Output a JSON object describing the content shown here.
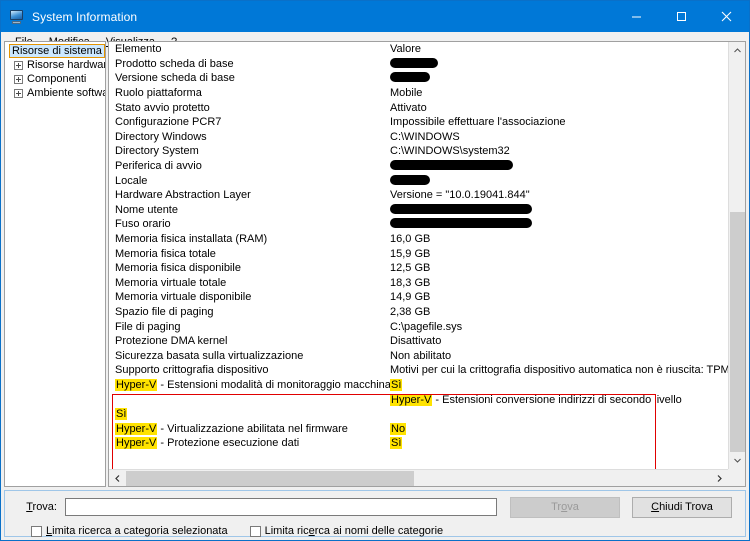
{
  "window": {
    "title": "System Information",
    "icon": "system-information-icon",
    "minimize": "–",
    "maximize": "□",
    "close": "✕"
  },
  "menu": [
    {
      "label": "File",
      "accel": "F"
    },
    {
      "label": "Modifica",
      "accel": "M"
    },
    {
      "label": "Visualizza",
      "accel": "V"
    },
    {
      "label": "?",
      "accel": ""
    }
  ],
  "tree": {
    "root": "Risorse di sistema",
    "children": [
      "Risorse hardware",
      "Componenti",
      "Ambiente software"
    ]
  },
  "list": {
    "columns": [
      "Elemento",
      "Valore"
    ],
    "rows": [
      {
        "item": "Prodotto scheda di base",
        "value": "",
        "redact": 48
      },
      {
        "item": "Versione scheda di base",
        "value": "",
        "redact": 40
      },
      {
        "item": "Ruolo piattaforma",
        "value": "Mobile"
      },
      {
        "item": "Stato avvio protetto",
        "value": "Attivato"
      },
      {
        "item": "Configurazione PCR7",
        "value": "Impossibile effettuare l'associazione"
      },
      {
        "item": "Directory Windows",
        "value": "C:\\WINDOWS"
      },
      {
        "item": "Directory System",
        "value": "C:\\WINDOWS\\system32"
      },
      {
        "item": "Periferica di avvio",
        "value": "",
        "redact": 123
      },
      {
        "item": "Locale",
        "value": "",
        "redact": 40
      },
      {
        "item": "Hardware Abstraction Layer",
        "value": "Versione = \"10.0.19041.844\""
      },
      {
        "item": "Nome utente",
        "value": "",
        "redact": 142
      },
      {
        "item": "Fuso orario",
        "value": "",
        "redact": 142
      },
      {
        "item": "Memoria fisica installata (RAM)",
        "value": "16,0 GB"
      },
      {
        "item": "Memoria fisica totale",
        "value": "15,9 GB"
      },
      {
        "item": "Memoria fisica disponibile",
        "value": "12,5 GB"
      },
      {
        "item": "Memoria virtuale totale",
        "value": "18,3 GB"
      },
      {
        "item": "Memoria virtuale disponibile",
        "value": "14,9 GB"
      },
      {
        "item": "Spazio file di paging",
        "value": "2,38 GB"
      },
      {
        "item": "File di paging",
        "value": "C:\\pagefile.sys"
      },
      {
        "item": "Protezione DMA kernel",
        "value": "Disattivato"
      },
      {
        "item": "Sicurezza basata sulla virtualizzazione",
        "value": "Non abilitato"
      },
      {
        "item": "Supporto crittografia dispositivo",
        "value": "Motivi per cui la crittografia dispositivo automatica non è riuscita: TPM non util"
      }
    ],
    "hyperv": {
      "row1_label_hl": "Hyper-V",
      "row1_label_rest": " - Estensioni modalità di monitoraggio macchina virtuale",
      "row1_value": "Sì",
      "row2_label_hl": "Hyper-V",
      "row2_label_rest": " - Estensioni conversione indirizzi di secondo livello",
      "row3_value": "Sì",
      "row4_label_hl": "Hyper-V",
      "row4_label_rest": " - Virtualizzazione abilitata nel firmware",
      "row4_value": "No",
      "row5_label_hl": "Hyper-V",
      "row5_label_rest": " - Protezione esecuzione dati",
      "row5_value": "Sì"
    }
  },
  "find": {
    "label": "Trova:",
    "accel_label": "T",
    "input_value": "",
    "input_placeholder": "",
    "find_button": "Trova",
    "find_button_accel": "o",
    "close_button": "Chiudi Trova",
    "close_button_accel": "C",
    "checkbox1": "Limita ricerca a categoria selezionata",
    "checkbox1_accel": "L",
    "checkbox2": "Limita ricerca ai nomi delle categorie",
    "checkbox2_accel": "e"
  },
  "colors": {
    "titlebar": "#0078d7",
    "highlight": "#ffe300",
    "redbox": "#e00000",
    "selection": "#cce8ff"
  },
  "scroll": {
    "up_arrow": "˄",
    "down_arrow": "˅",
    "left_arrow": "‹",
    "right_arrow": "›"
  }
}
